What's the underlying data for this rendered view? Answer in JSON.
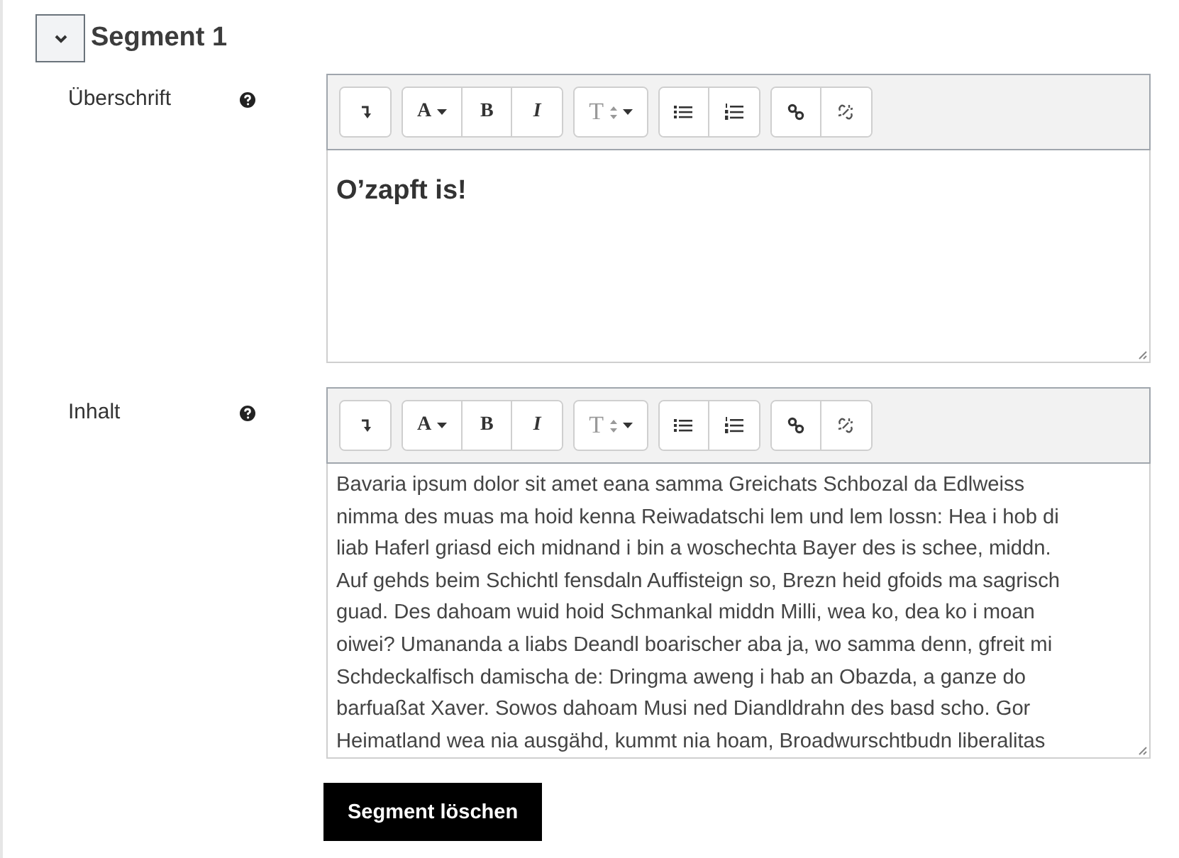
{
  "segment": {
    "title": "Segment 1",
    "expanded": true
  },
  "fields": [
    {
      "label": "Überschrift",
      "kind": "heading",
      "toolbar": [
        [
          {
            "kind": "undo"
          }
        ],
        [
          {
            "kind": "color",
            "label": "A"
          },
          {
            "kind": "bold",
            "label": "B"
          },
          {
            "kind": "italic",
            "label": "I"
          }
        ],
        [
          {
            "kind": "size",
            "label": "T"
          }
        ],
        [
          {
            "kind": "ul"
          },
          {
            "kind": "ol"
          }
        ],
        [
          {
            "kind": "link"
          },
          {
            "kind": "unlink"
          }
        ]
      ],
      "content": "O’zapft is!"
    },
    {
      "label": "Inhalt",
      "kind": "body",
      "toolbar": [
        [
          {
            "kind": "undo"
          }
        ],
        [
          {
            "kind": "color",
            "label": "A"
          },
          {
            "kind": "bold",
            "label": "B"
          },
          {
            "kind": "italic",
            "label": "I"
          }
        ],
        [
          {
            "kind": "size",
            "label": "T"
          }
        ],
        [
          {
            "kind": "ul"
          },
          {
            "kind": "ol"
          }
        ],
        [
          {
            "kind": "link"
          },
          {
            "kind": "unlink"
          }
        ]
      ],
      "content": "Bavaria ipsum dolor sit amet eana samma Greichats Schbozal da Edlweiss\nnimma des muas ma hoid kenna Reiwadatschi lem und lem lossn: Hea i hob di\nliab Haferl griasd eich midnand i bin a woschechta Bayer des is schee, middn.\nAuf gehds beim Schichtl fensdaln Auffisteign so, Brezn heid gfoids ma sagrisch\nguad. Des dahoam wuid hoid Schmankal middn Milli, wea ko, dea ko i moan\noiwei? Umananda a liabs Deandl boarischer aba ja, wo samma denn, gfreit mi\nSchdeckalfisch damischa de: Dringma aweng i hab an Obazda, a ganze do\nbarfuaßat Xaver. Sowos dahoam Musi ned Diandldrahn des basd scho. Gor\nHeimatland wea nia ausgähd, kummt nia hoam, Broadwurschtbudn liberalitas"
    }
  ],
  "delete_button": "Segment löschen"
}
